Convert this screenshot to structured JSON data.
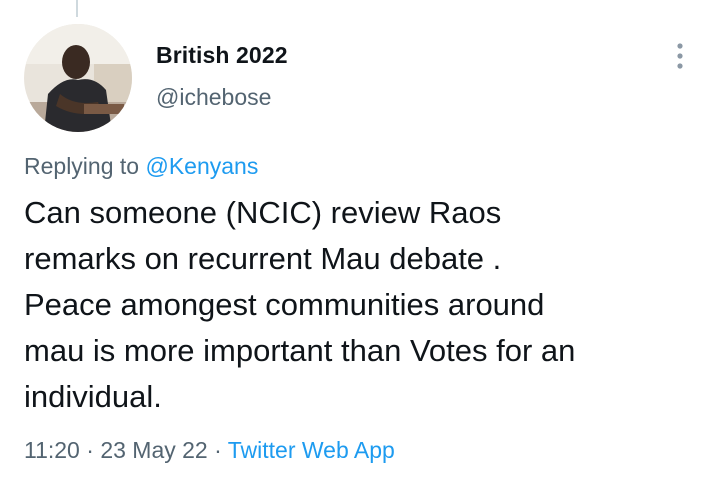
{
  "author": {
    "display_name": "British 2022",
    "handle": "@ichebose"
  },
  "reply": {
    "prefix": "Replying to ",
    "mention": "@Kenyans"
  },
  "tweet": {
    "text": "Can someone (NCIC) review Raos\nremarks on recurrent Mau debate .\nPeace amongest communities around\nmau is more important than Votes for an\nindividual."
  },
  "meta": {
    "time": "11:20",
    "separator": " · ",
    "date": "23 May 22",
    "source": "Twitter Web App"
  },
  "icons": {
    "more": "more-vertical-icon"
  },
  "colors": {
    "text": "#0f1419",
    "secondary": "#536471",
    "link": "#1d9bf0"
  }
}
